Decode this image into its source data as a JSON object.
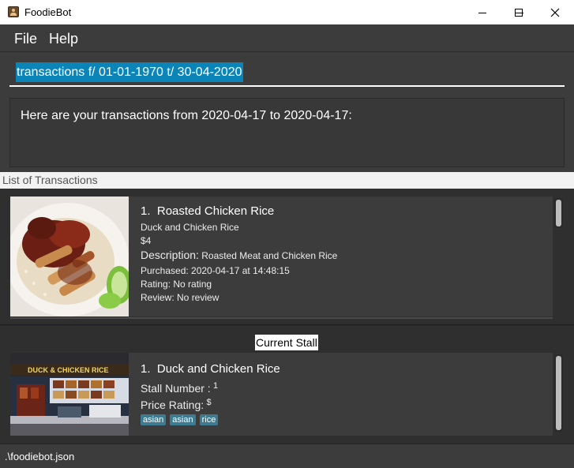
{
  "window": {
    "title": "FoodieBot",
    "icon": "app-icon"
  },
  "menu": {
    "items": [
      "File",
      "Help"
    ]
  },
  "command": {
    "value": "transactions f/ 01-01-1970 t/ 30-04-2020"
  },
  "result": {
    "text": "Here are your transactions from 2020-04-17 to 2020-04-17:"
  },
  "list_header": "List of Transactions",
  "transaction": {
    "index": "1.",
    "name": "Roasted Chicken Rice",
    "stall": "Duck and Chicken Rice",
    "price": "$4",
    "description_label": "Description:",
    "description": "Roasted Meat and Chicken Rice",
    "purchased": "Purchased: 2020-04-17 at 14:48:15",
    "rating": "Rating: No rating",
    "review": "Review: No review"
  },
  "current_stall": {
    "header": "Current Stall",
    "index": "1.",
    "name": "Duck and Chicken Rice",
    "stall_number_label": "Stall Number :",
    "stall_number": "1",
    "price_rating_label": "Price Rating:",
    "price_rating": "$",
    "tags": [
      "asian",
      "asian",
      "rice"
    ]
  },
  "status": {
    "file": ".\\foodiebot.json"
  },
  "colors": {
    "accent": "#0b84b8",
    "tag": "#3e7b91",
    "panel": "#3c3c3c",
    "background": "#2b2b2b"
  }
}
